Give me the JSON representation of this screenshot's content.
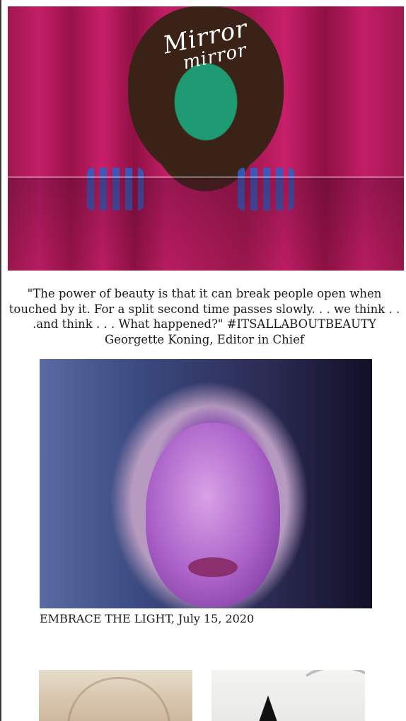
{
  "hero": {
    "logo_line_1": "Mirror",
    "logo_line_2": "mirror"
  },
  "quote": {
    "text": "\"The power of beauty is that it can break people open when touched by it. For a split second time passes slowly. . . we think . . .and think . . . What happened?\" #ITSALLABOUTBEAUTY Georgette Koning, Editor in Chief"
  },
  "featured": {
    "caption": "EMBRACE THE LIGHT, July 15, 2020"
  },
  "colors": {
    "hero_backdrop": "#c21e67",
    "hero_face_paint": "#1e9b72",
    "nail_glitter": "#2d5fc4",
    "portrait_light": "#a960c8"
  }
}
